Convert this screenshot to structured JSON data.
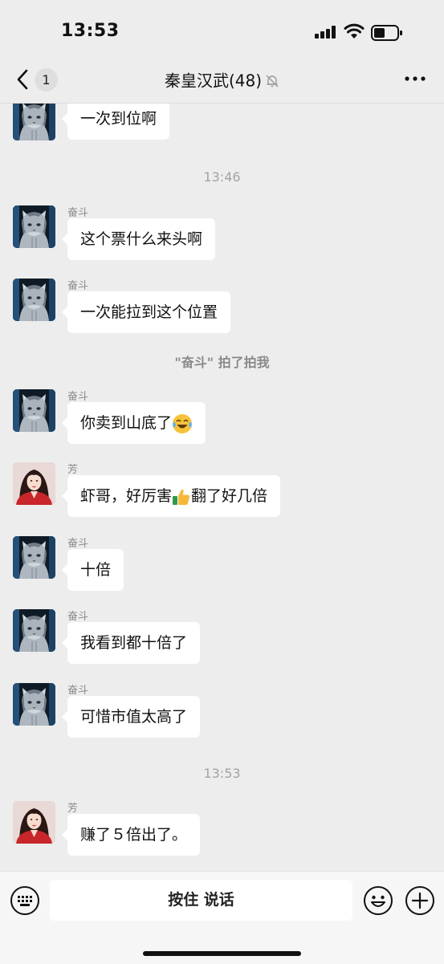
{
  "status_bar": {
    "time": "13:53"
  },
  "nav": {
    "unread_count": "1",
    "title": "秦皇汉武(48)"
  },
  "messages": [
    {
      "type": "text",
      "avatar": "cat-avatar",
      "text": "一次到位啊"
    },
    {
      "type": "time",
      "text": "13:46"
    },
    {
      "type": "text",
      "sender": "奋斗",
      "avatar": "cat-avatar",
      "text": "这个票什么来头啊"
    },
    {
      "type": "text",
      "sender": "奋斗",
      "avatar": "cat-avatar",
      "text": "一次能拉到这个位置"
    },
    {
      "type": "system",
      "quoted_name": "\"奋斗\"",
      "action": " 拍了拍我"
    },
    {
      "type": "text",
      "sender": "奋斗",
      "avatar": "cat-avatar",
      "text": "你卖到山底了",
      "emoji": "crying-laughing-emoji"
    },
    {
      "type": "text",
      "sender": "芳",
      "avatar": "woman-avatar",
      "text_before": "虾哥，好厉害",
      "emoji": "thumbs-up-emoji",
      "text_after": "翻了好几倍"
    },
    {
      "type": "text",
      "sender": "奋斗",
      "avatar": "cat-avatar",
      "text": "十倍"
    },
    {
      "type": "text",
      "sender": "奋斗",
      "avatar": "cat-avatar",
      "text": "我看到都十倍了"
    },
    {
      "type": "text",
      "sender": "奋斗",
      "avatar": "cat-avatar",
      "text": "可惜市值太高了"
    },
    {
      "type": "time",
      "text": "13:53"
    },
    {
      "type": "text",
      "sender": "芳",
      "avatar": "woman-avatar",
      "text": "赚了５倍出了。"
    }
  ],
  "input_bar": {
    "voice_label": "按住 说话"
  },
  "colors": {
    "background": "#ededed",
    "bubble": "#ffffff",
    "meta_text": "#a3a3a3"
  },
  "icons": [
    "back-chevron-icon",
    "mute-bell-icon",
    "more-icon",
    "signal-icon",
    "wifi-icon",
    "battery-icon",
    "keyboard-icon",
    "emoji-icon",
    "plus-icon"
  ]
}
